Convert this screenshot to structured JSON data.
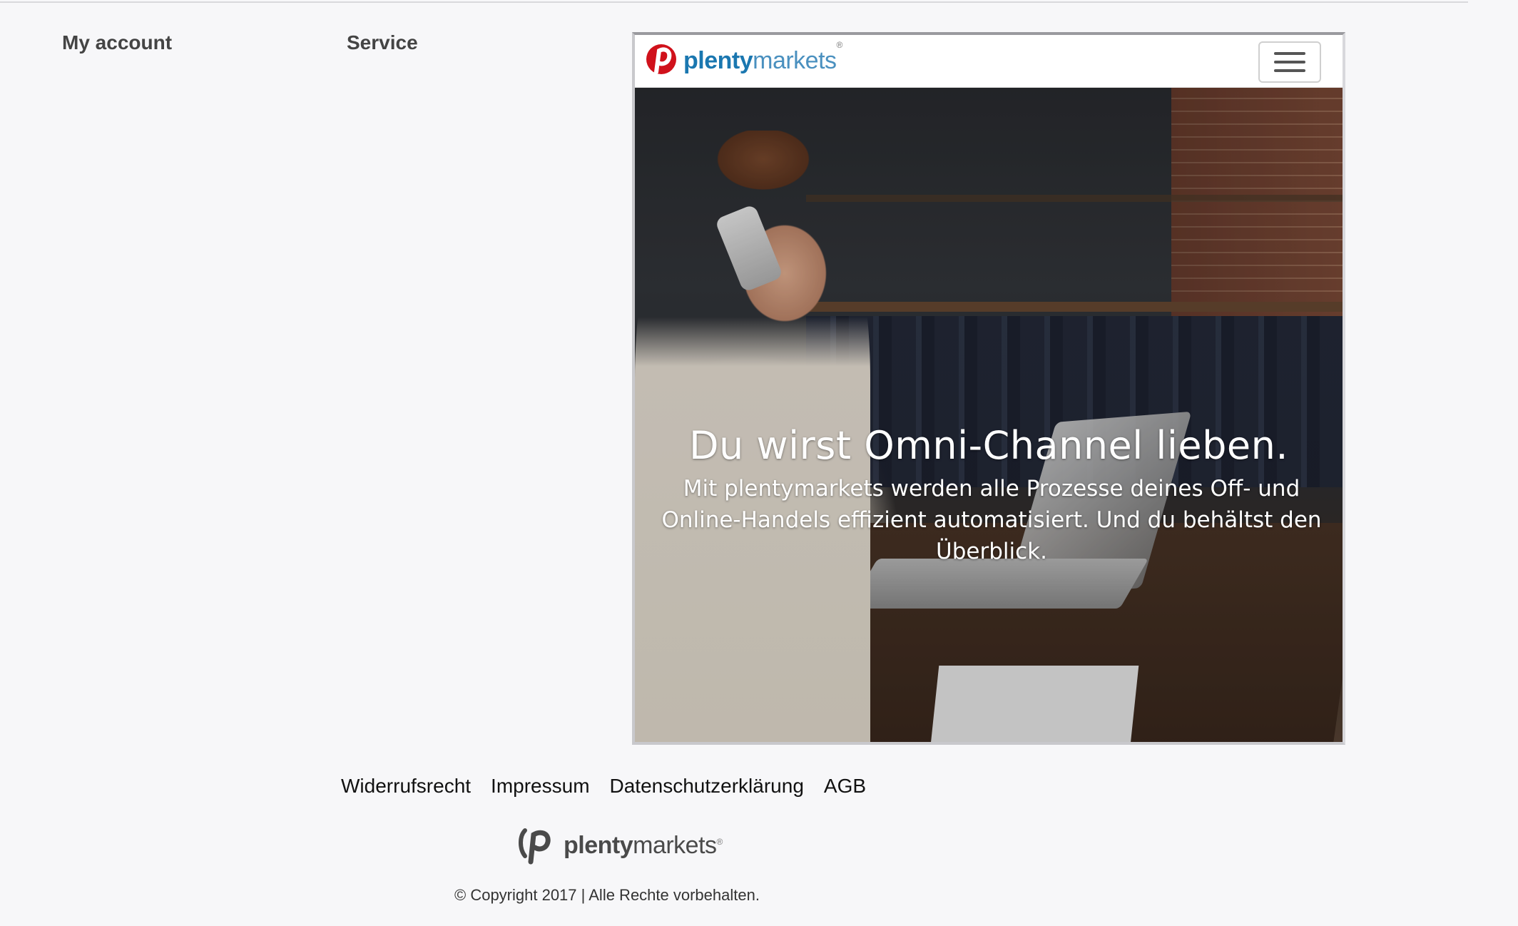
{
  "columns": {
    "my_account": "My account",
    "service": "Service"
  },
  "preview": {
    "brand": {
      "part1": "plenty",
      "part2": "markets",
      "registered": "®"
    },
    "menu_icon": "hamburger-menu-icon",
    "hero": {
      "title": "Du wirst Omni-Channel lieben.",
      "subtitle": "Mit plentymarkets werden alle Prozesse deines Off- und Online-Handels effizient automatisiert. Und du behältst den Überblick."
    },
    "colors": {
      "brand_red": "#d0111b",
      "brand_blue": "#1a77b0"
    }
  },
  "footer": {
    "links": [
      "Widerrufsrecht",
      "Impressum",
      "Datenschutzerklärung",
      "AGB"
    ],
    "brand": {
      "part1": "plenty",
      "part2": "markets",
      "registered": "®"
    },
    "copyright": "© Copyright 2017 | Alle Rechte vorbehalten."
  }
}
